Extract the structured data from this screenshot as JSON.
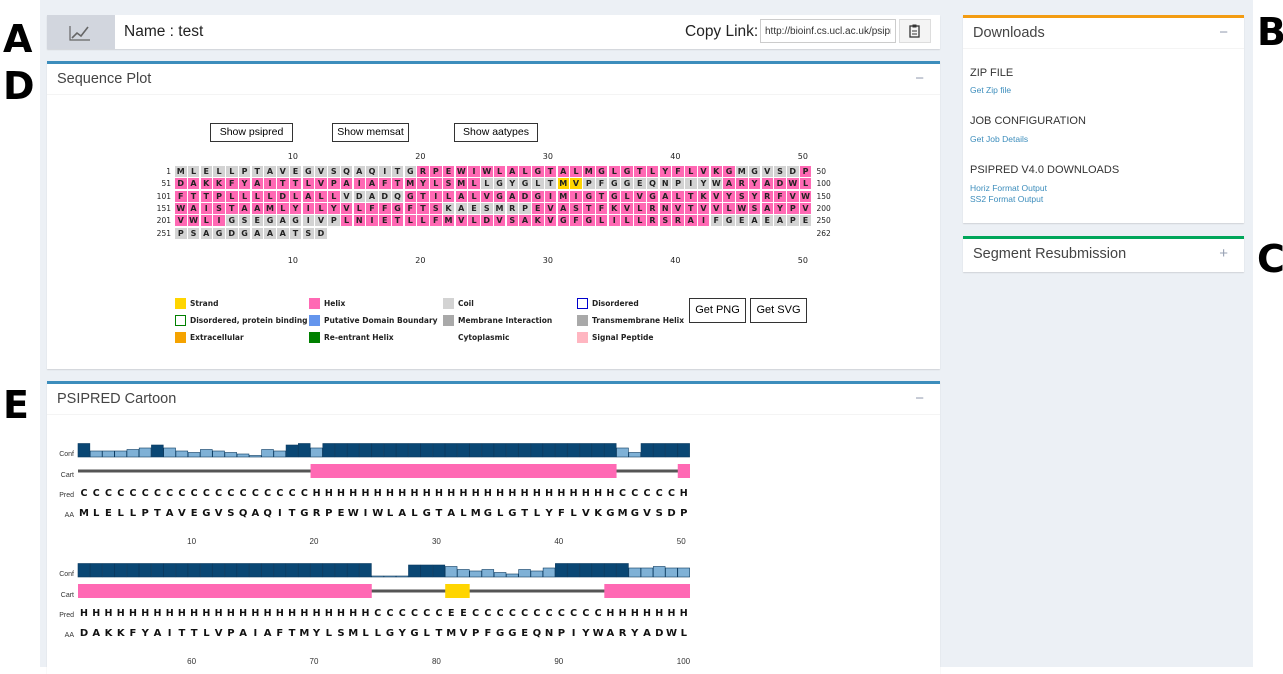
{
  "panel_letters": {
    "a": "A",
    "b": "B",
    "c": "C",
    "d": "D",
    "e": "E"
  },
  "name_bar": {
    "chart_icon": "line-chart-icon",
    "name_label": "Name : test",
    "copy_link_label": "Copy Link:",
    "copy_link_value": "http://bioinf.cs.ucl.ac.uk/psipred",
    "copy_icon": "clipboard-icon"
  },
  "sequence_plot": {
    "title": "Sequence Plot",
    "collapse_symbol": "−",
    "buttons": {
      "psipred": "Show psipred",
      "memsat": "Show memsat",
      "aatypes": "Show aatypes"
    },
    "ticks": [
      "10",
      "20",
      "30",
      "40",
      "50"
    ],
    "rows": [
      {
        "start": "1",
        "end": "50",
        "seq": "MLELLPTAVEGVSQAQITGRPEWIWLALGTALMGLGTLYFLVKGMGVSDP",
        "ss": "CCCCCCCCCCCCCCCCCCCHHHHHHHHHHHHHHHHHHHHHHHHHCCCCCH"
      },
      {
        "start": "51",
        "end": "100",
        "seq": "DAKKFYAITTLVPAIAFTMYLSMLLGYGLTMVPFGGEQNPIYWARYADWL",
        "ss": "HHHHHHHHHHHHHHHHHHHHHHHHCCCCCCEECCCCCCCCCCCHHHHHHH"
      },
      {
        "start": "101",
        "end": "150",
        "seq": "FTTPLLLLDLALLVDADQGTILALVGADGIMIGTGLVGALTKVYSYRFVW",
        "ss": "HHHHHHHHHHHHHCCCCCHHHHHHHHHHHHHHHHHHHHHHHHHHHHHHHH"
      },
      {
        "start": "151",
        "end": "200",
        "seq": "WAISTAAMLYILYVLFFGFTSKAESMRPEVASTFKVLRNVTVVLWSAYPV",
        "ss": "HHHHHHHHHHHHHHHHHHHHHCCCCCCCHHHHHHHHHHHHHHHHHHHHHH"
      },
      {
        "start": "201",
        "end": "250",
        "seq": "VWLIGSEGAGIVPLNIETLLFMVLDVSAKVGFGLILLRSRAIFGEAEAPE",
        "ss": "HHHHCCCCCCCCCHHHHHHHHHHHHHHHHHHHHHHHHHHHHHCCCCCCCC"
      },
      {
        "start": "251",
        "end": "262",
        "seq": "PSAGDGAAATSD",
        "ss": "CCCCCCCCCCCC"
      }
    ],
    "legend": [
      {
        "label": "Strand",
        "color": "#ffd500",
        "border": "#ffd500"
      },
      {
        "label": "Helix",
        "color": "#ff69b4",
        "border": "#ff69b4"
      },
      {
        "label": "Coil",
        "color": "#d3d3d3",
        "border": "#d3d3d3"
      },
      {
        "label": "Disordered",
        "color": "#ffffff",
        "border": "#0000cd"
      },
      {
        "label": "Disordered, protein binding",
        "color": "#ffffff",
        "border": "#008000"
      },
      {
        "label": "Putative Domain Boundary",
        "color": "#6495ed",
        "border": "#6495ed"
      },
      {
        "label": "Membrane Interaction",
        "color": "#a9a9a9",
        "border": "#a9a9a9"
      },
      {
        "label": "Transmembrane Helix",
        "color": "#a9a9a9",
        "border": "#a9a9a9"
      },
      {
        "label": "Extracellular",
        "color": "#f5a300",
        "border": "#f5a300"
      },
      {
        "label": "Re-entrant Helix",
        "color": "#008000",
        "border": "#008000"
      },
      {
        "label": "Cytoplasmic",
        "color": "",
        "border": ""
      },
      {
        "label": "Signal Peptide",
        "color": "#ffb6c1",
        "border": "#ffb6c1"
      }
    ],
    "export_buttons": {
      "png": "Get PNG",
      "svg": "Get SVG"
    },
    "colors": {
      "helix": "#ff69b4",
      "strand": "#ffd500",
      "coil": "#d3d3d3"
    }
  },
  "psipred_cartoon": {
    "title": "PSIPRED Cartoon",
    "collapse_symbol": "−",
    "row_labels": {
      "conf": "Conf",
      "cart": "Cart",
      "pred": "Pred",
      "aa": "AA"
    },
    "blocks": [
      {
        "aa": "MLELLPTAVEGVSQAQITGRPEWIWLALGTALMGLGTLYFLVKGMGVSDP",
        "pred": "CCCCCCCCCCCCCCCCCCCHHHHHHHHHHHHHHHHHHHHHHHHHCCCCCH",
        "conf": [
          9,
          4,
          4,
          4,
          5,
          6,
          8,
          6,
          4,
          3,
          5,
          4,
          3,
          2,
          1,
          5,
          4,
          8,
          9,
          6,
          9,
          9,
          9,
          9,
          9,
          9,
          9,
          9,
          9,
          9,
          9,
          9,
          9,
          9,
          9,
          9,
          9,
          9,
          9,
          9,
          9,
          9,
          9,
          9,
          6,
          3,
          9,
          9,
          9,
          9
        ],
        "ticks": [
          "10",
          "20",
          "30",
          "40",
          "50"
        ]
      },
      {
        "aa": "DAKKFYAITTLVPAIAFTMYLSMLLGYGLTMVPFGGEQNPIYWARYADWL",
        "pred": "HHHHHHHHHHHHHHHHHHHHHHHHCCCCCCEECCCCCCCCCCCHHHHHHH",
        "conf": [
          9,
          9,
          9,
          9,
          9,
          9,
          9,
          9,
          9,
          9,
          9,
          9,
          9,
          9,
          9,
          9,
          9,
          9,
          9,
          9,
          9,
          9,
          9,
          9,
          0,
          0,
          0,
          8,
          8,
          8,
          7,
          5,
          4,
          5,
          3,
          2,
          5,
          4,
          6,
          9,
          9,
          9,
          9,
          9,
          9,
          6,
          6,
          7,
          6,
          6
        ],
        "ticks": [
          "60",
          "70",
          "80",
          "90",
          "100"
        ]
      }
    ],
    "colors": {
      "helix": "#ff69b4",
      "strand": "#ffd500",
      "coil": "#555555",
      "conf_dark": "#0a4774",
      "conf_light": "#7fb1d6"
    }
  },
  "downloads": {
    "title": "Downloads",
    "collapse_symbol": "−",
    "sections": [
      {
        "heading": "ZIP FILE",
        "links": [
          "Get Zip file"
        ]
      },
      {
        "heading": "JOB CONFIGURATION",
        "links": [
          "Get Job Details"
        ]
      },
      {
        "heading": "PSIPRED V4.0 DOWNLOADS",
        "links": [
          "Horiz Format Output",
          "SS2 Format Output"
        ]
      }
    ]
  },
  "segment_resubmission": {
    "title": "Segment Resubmission",
    "expand_symbol": "+"
  }
}
